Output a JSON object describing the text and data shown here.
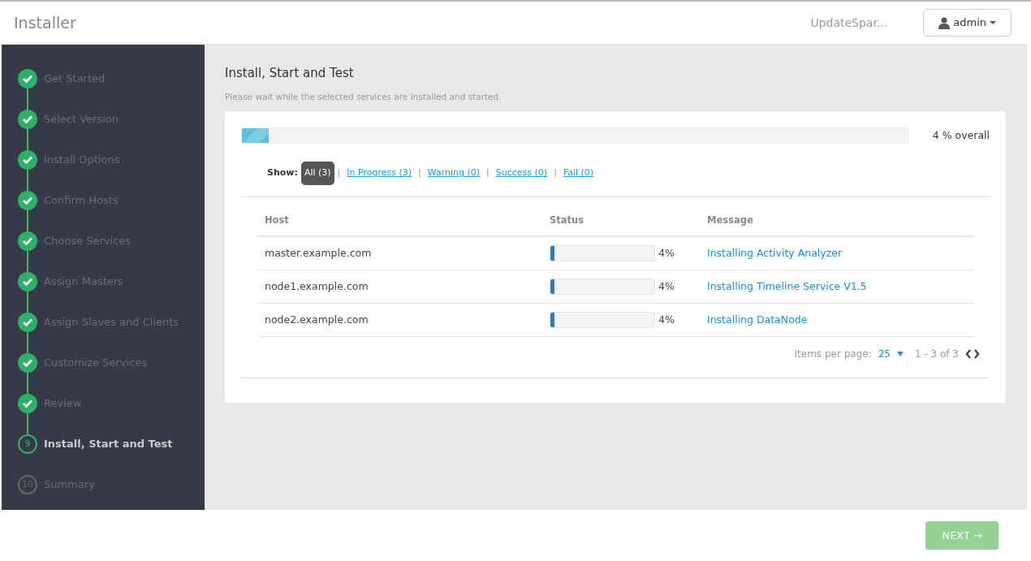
{
  "header": {
    "title": "Installer",
    "cluster": "UpdateSpar...",
    "user_menu": "admin"
  },
  "steps": [
    {
      "label": "Get Started",
      "kind": "done"
    },
    {
      "label": "Select Version",
      "kind": "done"
    },
    {
      "label": "Install Options",
      "kind": "done"
    },
    {
      "label": "Confirm Hosts",
      "kind": "done"
    },
    {
      "label": "Choose Services",
      "kind": "done"
    },
    {
      "label": "Assign Masters",
      "kind": "done"
    },
    {
      "label": "Assign Slaves and Clients",
      "kind": "done"
    },
    {
      "label": "Customize Services",
      "kind": "done"
    },
    {
      "label": "Review",
      "kind": "done"
    },
    {
      "label": "Install, Start and Test",
      "kind": "current",
      "number": "9"
    },
    {
      "label": "Summary",
      "kind": "pending",
      "number": "10"
    }
  ],
  "page": {
    "title": "Install, Start and Test",
    "subtitle": "Please wait while the selected services are installed and started."
  },
  "overall": {
    "level": 0.04,
    "reading": "4 % overall"
  },
  "filter": {
    "label": "Show:",
    "separator": "|",
    "options": [
      {
        "label": "All (3)",
        "selected": true
      },
      {
        "label": "In Progress (3)",
        "selected": false
      },
      {
        "label": "Warning (0)",
        "selected": false
      },
      {
        "label": "Success (0)",
        "selected": false
      },
      {
        "label": "Fail (0)",
        "selected": false
      }
    ]
  },
  "table": {
    "columns": [
      "Host",
      "Status",
      "Message"
    ],
    "rows": [
      {
        "host": "master.example.com",
        "level": 0.04,
        "reading": "4%",
        "message": "Installing Activity Analyzer"
      },
      {
        "host": "node1.example.com",
        "level": 0.04,
        "reading": "4%",
        "message": "Installing Timeline Service V1.5"
      },
      {
        "host": "node2.example.com",
        "level": 0.04,
        "reading": "4%",
        "message": "Installing DataNode"
      }
    ]
  },
  "pagination": {
    "label": "Items per page:",
    "per_page": "25",
    "range": "1 - 3 of 3"
  },
  "next_button": {
    "label": "NEXT →",
    "disabled": true
  }
}
